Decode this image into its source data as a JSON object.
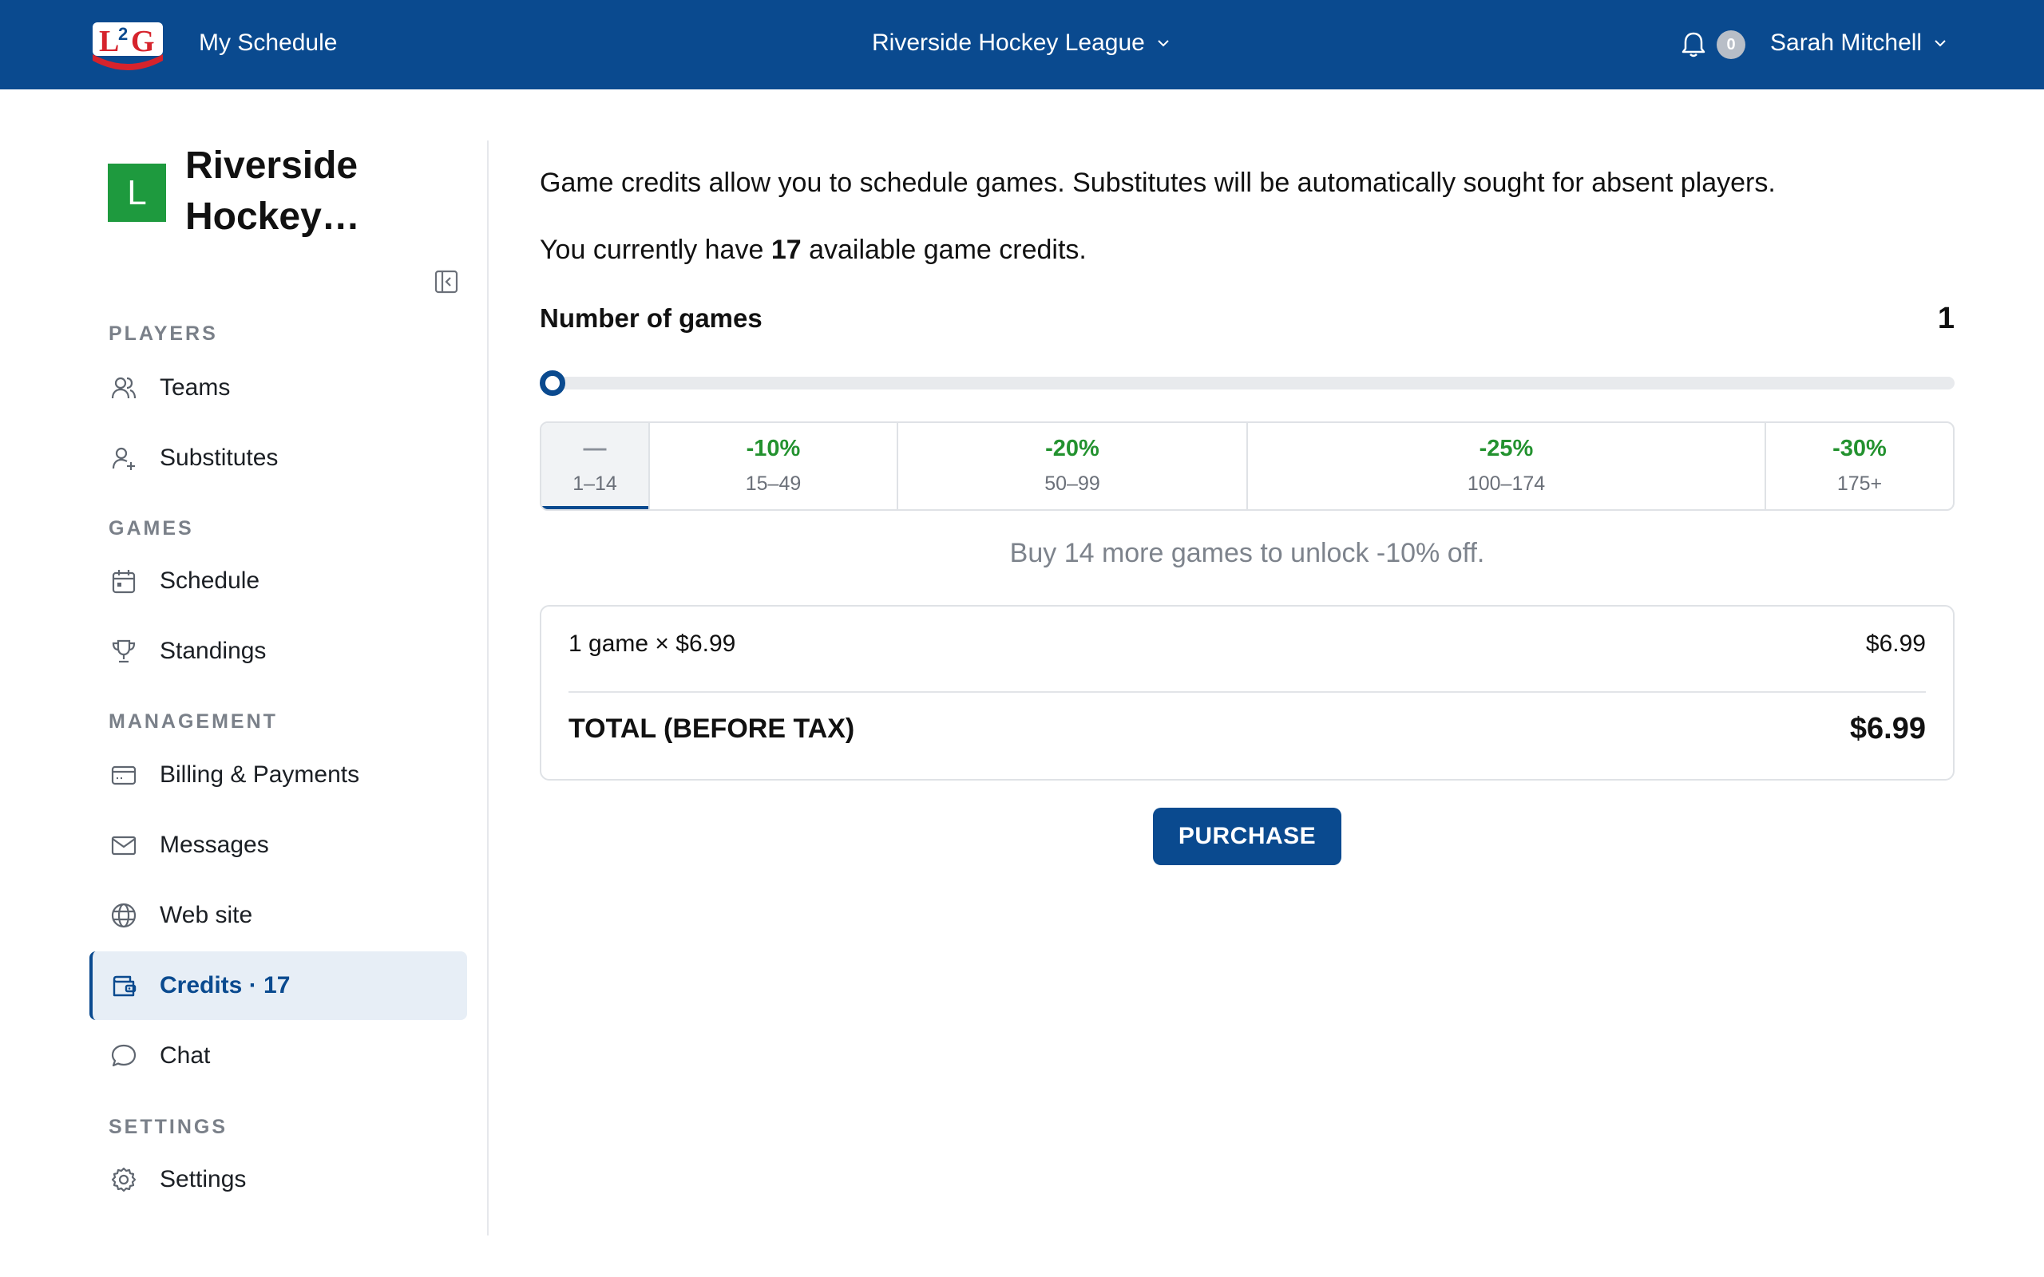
{
  "topbar": {
    "logo_text": "L2G",
    "my_schedule": "My Schedule",
    "league": "Riverside Hockey League",
    "notifications_count": "0",
    "user_name": "Sarah Mitchell",
    "colors": {
      "bar": "#0a4a8f",
      "badge": "#b8bec7"
    }
  },
  "sidebar": {
    "org_initial": "L",
    "org_name": "Riverside Hockey…",
    "org_color": "#1e9a3e",
    "sections": {
      "players": "PLAYERS",
      "games": "GAMES",
      "management": "MANAGEMENT",
      "settings": "SETTINGS"
    },
    "items": {
      "teams": {
        "label": "Teams",
        "icon": "users-icon"
      },
      "substitutes": {
        "label": "Substitutes",
        "icon": "user-plus-icon"
      },
      "schedule": {
        "label": "Schedule",
        "icon": "calendar-icon"
      },
      "standings": {
        "label": "Standings",
        "icon": "trophy-icon"
      },
      "billing": {
        "label": "Billing & Payments",
        "icon": "credit-card-icon"
      },
      "messages": {
        "label": "Messages",
        "icon": "envelope-icon"
      },
      "website": {
        "label": "Web site",
        "icon": "globe-icon"
      },
      "credits": {
        "label": "Credits · 17",
        "icon": "wallet-icon",
        "active": true
      },
      "chat": {
        "label": "Chat",
        "icon": "chat-bubble-icon"
      },
      "settings": {
        "label": "Settings",
        "icon": "gear-icon"
      }
    }
  },
  "main": {
    "intro": "Game credits allow you to schedule games. Substitutes will be automatically sought for absent players.",
    "credits_prefix": "You currently have ",
    "credits_count": "17",
    "credits_suffix": " available game credits.",
    "games_label": "Number of games",
    "games_value": "1",
    "slider": {
      "min": 1,
      "value": 1
    },
    "tiers": [
      {
        "discount": "—",
        "range": "1–14",
        "active": true
      },
      {
        "discount": "-10%",
        "range": "15–49"
      },
      {
        "discount": "-20%",
        "range": "50–99"
      },
      {
        "discount": "-25%",
        "range": "100–174"
      },
      {
        "discount": "-30%",
        "range": "175+"
      }
    ],
    "unlock_hint": "Buy 14 more games to unlock -10% off.",
    "summary": {
      "line_desc": "1 game × $6.99",
      "line_amount": "$6.99",
      "total_label": "TOTAL (BEFORE TAX)",
      "total_amount": "$6.99"
    },
    "purchase_label": "PURCHASE",
    "accent_color": "#0a4a8f",
    "discount_color": "#23922f"
  }
}
